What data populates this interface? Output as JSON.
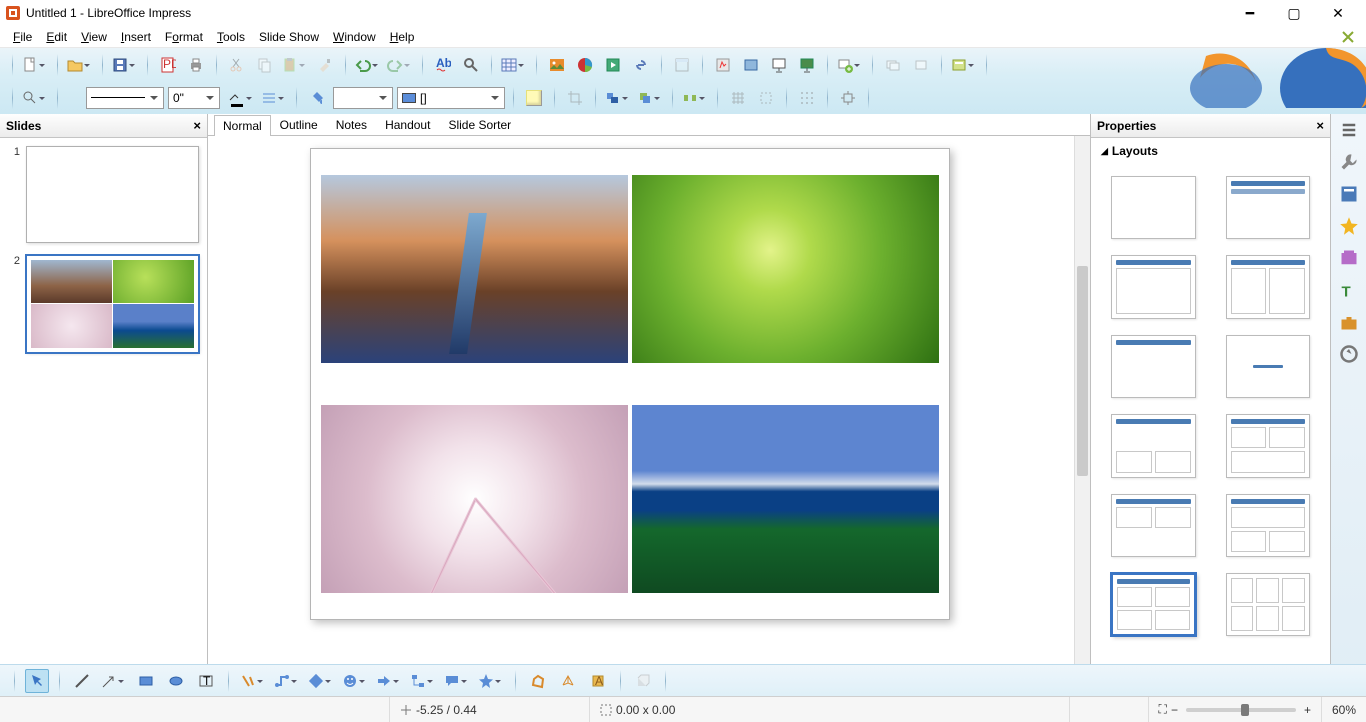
{
  "title": "Untitled 1 - LibreOffice Impress",
  "menu": {
    "file": "File",
    "edit": "Edit",
    "view": "View",
    "insert": "Insert",
    "format": "Format",
    "tools": "Tools",
    "slideshow": "Slide Show",
    "window": "Window",
    "help": "Help"
  },
  "slidesPanel": {
    "title": "Slides",
    "slides": [
      {
        "num": "1"
      },
      {
        "num": "2"
      }
    ],
    "selected": 2
  },
  "viewTabs": {
    "normal": "Normal",
    "outline": "Outline",
    "notes": "Notes",
    "handout": "Handout",
    "sorter": "Slide Sorter",
    "active": "normal"
  },
  "lineWidth": "0\"",
  "arrowStyle": "[]",
  "properties": {
    "title": "Properties",
    "layouts": "Layouts"
  },
  "status": {
    "coords": "-5.25 / 0.44",
    "size": "0.00 x 0.00",
    "zoom": "60%",
    "plus": "+",
    "minus": "−"
  }
}
